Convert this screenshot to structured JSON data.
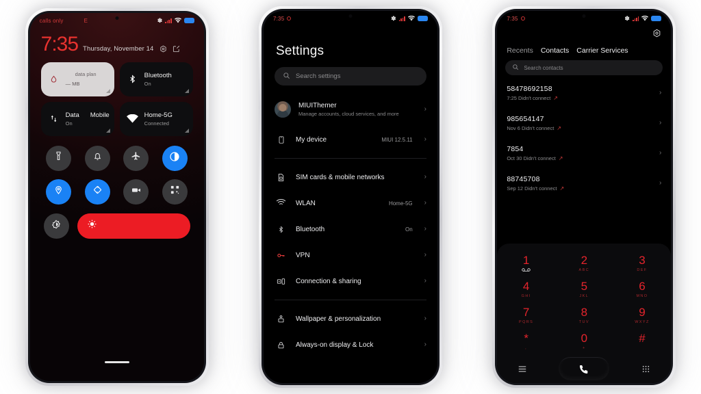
{
  "background_color": "#ffffff",
  "accent_colors": {
    "red": "#e8322f",
    "blue": "#1a82f5",
    "brightness_red": "#ec1c24",
    "dialer_red": "#e5242c"
  },
  "phone1": {
    "name": "Lock screen and control center",
    "status_bar": {
      "carrier_text": "calls only",
      "secondary_text": "E",
      "icons": [
        "bluetooth-icon",
        "signal-icon",
        "wifi-icon",
        "battery-icon"
      ]
    },
    "clock": "7:35",
    "date": "Thursday, November 14",
    "header_icons": [
      "settings-gear-icon",
      "edit-icon"
    ],
    "tiles": [
      {
        "title": "data plan",
        "value": "— MB",
        "icon": "water-drop-icon",
        "style": "light"
      },
      {
        "title": "Bluetooth",
        "value": "On",
        "icon": "bluetooth-icon",
        "style": "dark"
      },
      {
        "title": "Data",
        "title2": "Mobile",
        "value": "On",
        "icon": "data-transfer-icon",
        "style": "dark"
      },
      {
        "title": "Home-5G",
        "value": "Connected",
        "icon": "wifi-icon",
        "style": "dark"
      }
    ],
    "toggles": [
      {
        "name": "flashlight",
        "icon": "flashlight-icon",
        "active": false
      },
      {
        "name": "sound",
        "icon": "bell-icon",
        "active": false
      },
      {
        "name": "airplane-mode",
        "icon": "airplane-icon",
        "active": false
      },
      {
        "name": "dark-mode",
        "icon": "contrast-icon",
        "active": true
      },
      {
        "name": "location",
        "icon": "location-pin-icon",
        "active": true
      },
      {
        "name": "auto-rotate",
        "icon": "rotate-icon",
        "active": true
      },
      {
        "name": "screen-recorder",
        "icon": "video-camera-icon",
        "active": false
      },
      {
        "name": "scan-qr",
        "icon": "qr-code-icon",
        "active": false
      },
      {
        "name": "auto-brightness",
        "icon": "brightness-auto-icon",
        "active": false
      }
    ],
    "brightness_slider": {
      "icon": "sun-icon",
      "level_percent": 100
    }
  },
  "phone2": {
    "name": "Settings app",
    "status_bar": {
      "time": "7:35",
      "icons": [
        "alarm-icon",
        "bluetooth-icon",
        "signal-icon",
        "wifi-icon",
        "battery-icon"
      ]
    },
    "title": "Settings",
    "search_placeholder": "Search settings",
    "items": [
      {
        "label": "MIUIThemer",
        "sub": "Manage accounts, cloud services, and more",
        "value": "",
        "icon": "avatar"
      },
      {
        "label": "My device",
        "sub": "",
        "value": "MIUI 12.5.11",
        "icon": "phone-device-icon"
      },
      {
        "label": "SIM cards & mobile networks",
        "sub": "",
        "value": "",
        "icon": "sim-card-icon"
      },
      {
        "label": "WLAN",
        "sub": "",
        "value": "Home-5G",
        "icon": "wifi-icon"
      },
      {
        "label": "Bluetooth",
        "sub": "",
        "value": "On",
        "icon": "bluetooth-icon"
      },
      {
        "label": "VPN",
        "sub": "",
        "value": "",
        "icon": "key-icon"
      },
      {
        "label": "Connection & sharing",
        "sub": "",
        "value": "",
        "icon": "connection-sharing-icon"
      },
      {
        "label": "Wallpaper & personalization",
        "sub": "",
        "value": "",
        "icon": "wallpaper-icon"
      },
      {
        "label": "Always-on display & Lock",
        "sub": "",
        "value": "",
        "icon": "lock-icon"
      }
    ]
  },
  "phone3": {
    "name": "Phone dialer",
    "status_bar": {
      "time": "7:35",
      "icons": [
        "alarm-icon",
        "bluetooth-icon",
        "signal-icon",
        "wifi-icon",
        "battery-icon"
      ]
    },
    "gear_icon": "settings-gear-icon",
    "tabs": [
      {
        "label": "Recents",
        "active": false
      },
      {
        "label": "Contacts",
        "active": true
      },
      {
        "label": "Carrier Services",
        "active": true
      }
    ],
    "search_placeholder": "Search contacts",
    "calls": [
      {
        "number": "58478692158",
        "meta": "7:25 Didn't connect",
        "direction": "outgoing"
      },
      {
        "number": "985654147",
        "meta": "Nov 6 Didn't connect",
        "direction": "outgoing"
      },
      {
        "number": "7854",
        "meta": "Oct 30 Didn't connect",
        "direction": "outgoing"
      },
      {
        "number": "88745708",
        "meta": "Sep 12 Didn't connect",
        "direction": "outgoing"
      }
    ],
    "keypad": [
      {
        "digit": "1",
        "letters": "voicemail-icon"
      },
      {
        "digit": "2",
        "letters": "ABC"
      },
      {
        "digit": "3",
        "letters": "DEF"
      },
      {
        "digit": "4",
        "letters": "GHI"
      },
      {
        "digit": "5",
        "letters": "JKL"
      },
      {
        "digit": "6",
        "letters": "MNO"
      },
      {
        "digit": "7",
        "letters": "PQRS"
      },
      {
        "digit": "8",
        "letters": "TUV"
      },
      {
        "digit": "9",
        "letters": "WXYZ"
      },
      {
        "digit": "*",
        "letters": ","
      },
      {
        "digit": "0",
        "letters": "+"
      },
      {
        "digit": "#",
        "letters": ""
      }
    ],
    "bottom_bar": [
      {
        "name": "menu-icon"
      },
      {
        "name": "call-button"
      },
      {
        "name": "keypad-icon"
      }
    ]
  }
}
